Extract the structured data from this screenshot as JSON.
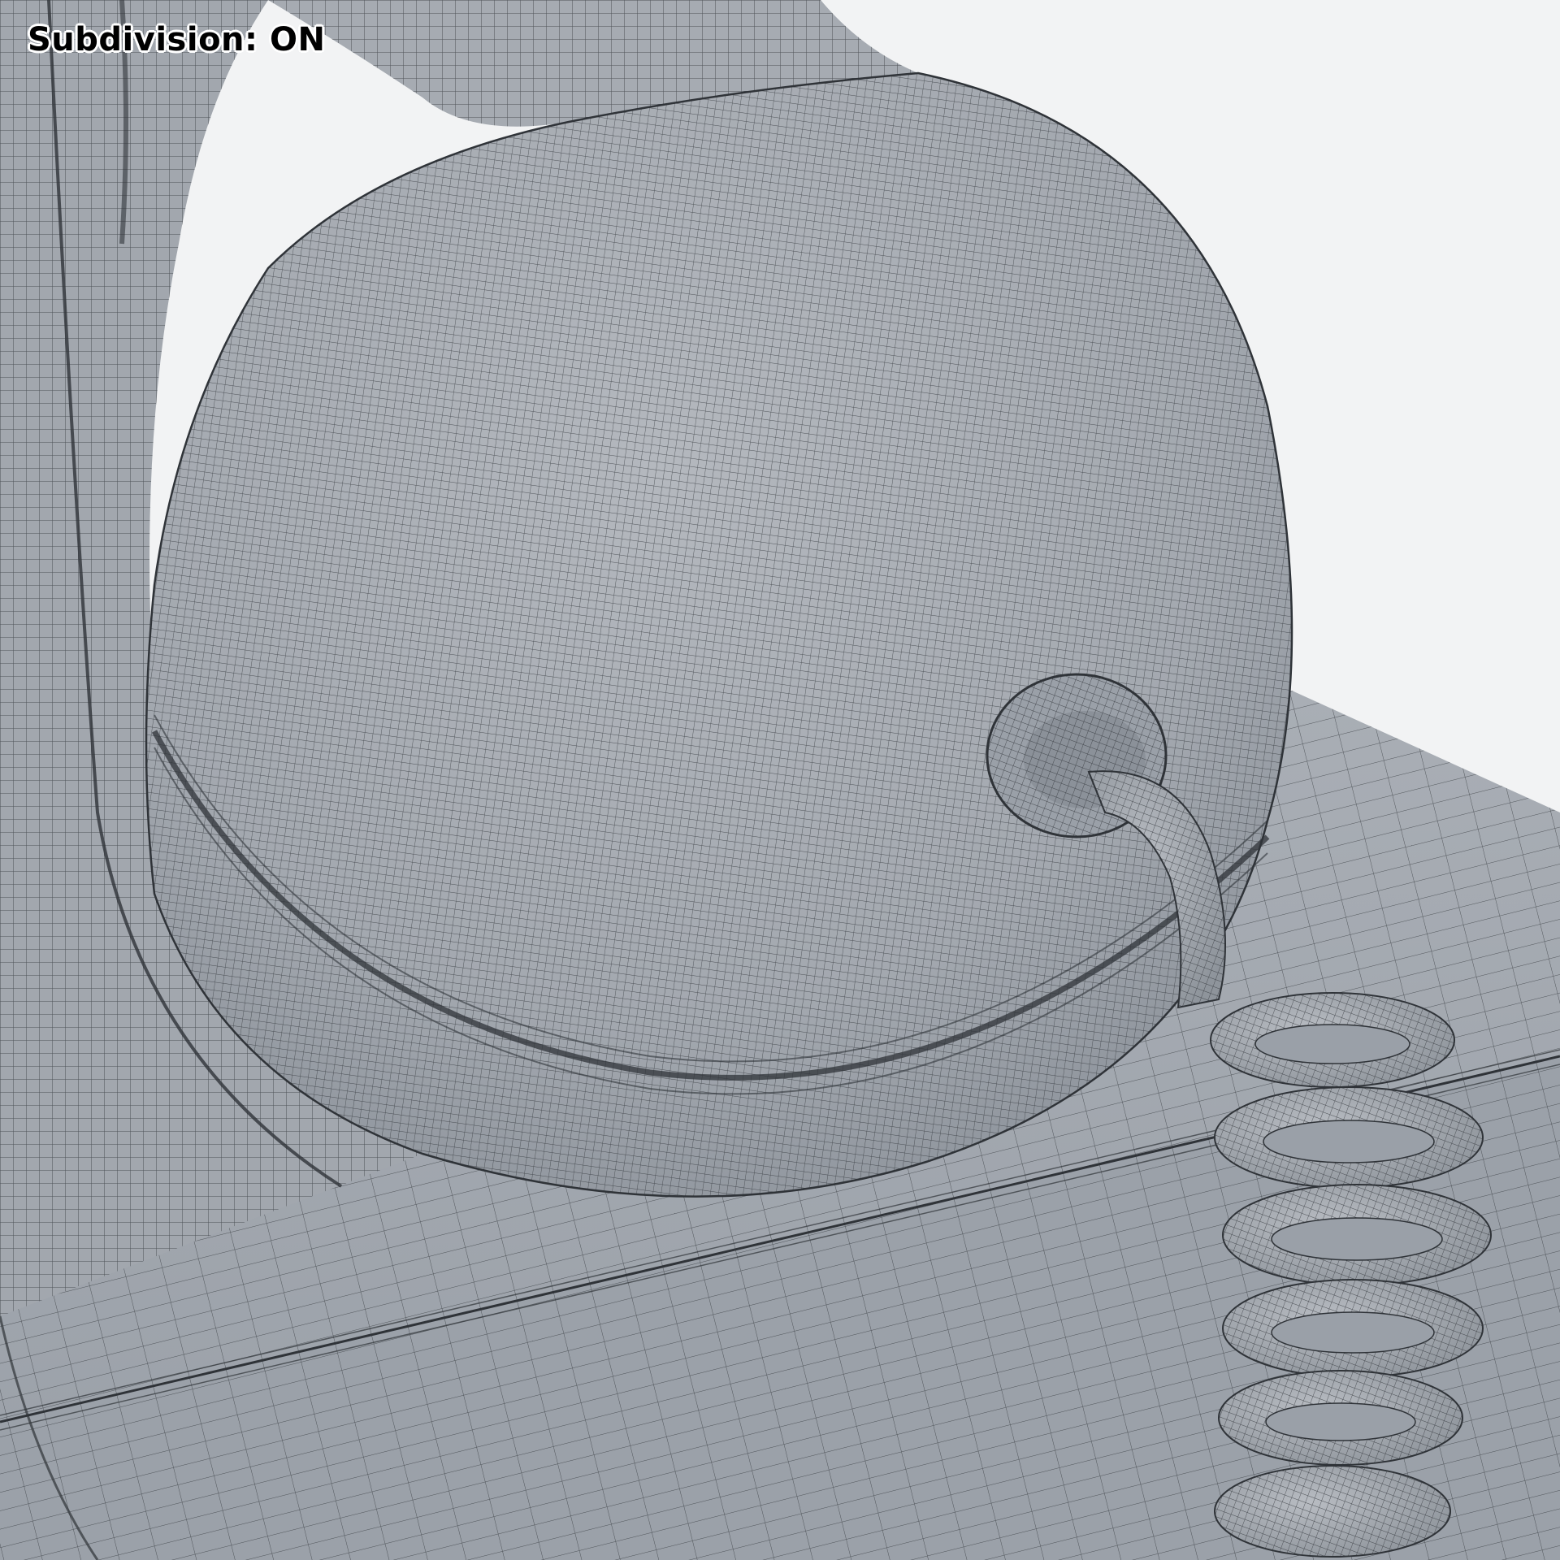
{
  "overlay": {
    "subdivision_label": "Subdivision: ON"
  },
  "colors": {
    "background": "#f2f3f4",
    "mesh_fill": "#a8adb4",
    "mesh_shadow": "#8f959d",
    "mesh_highlight": "#c2c6cb",
    "wireframe": "#2f3338"
  },
  "icons": {
    "viewport": "3d-wireframe-render"
  }
}
